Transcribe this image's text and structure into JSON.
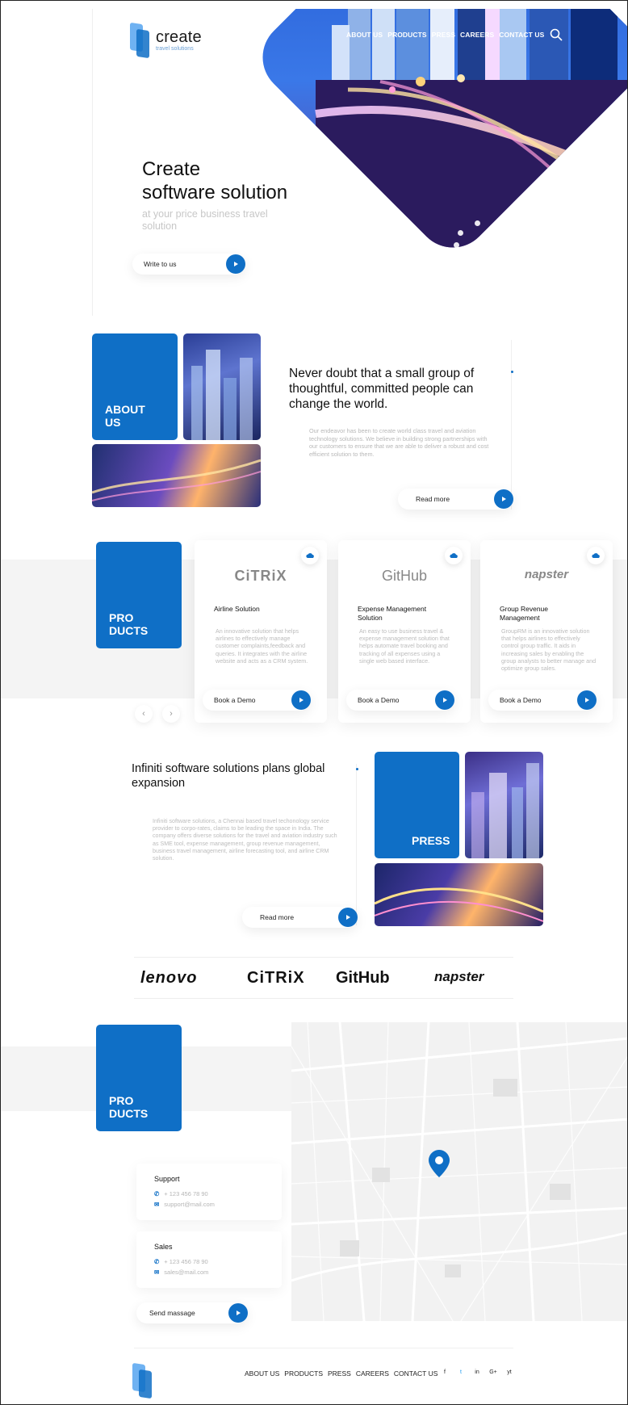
{
  "brand": {
    "name": "create",
    "tagline": "travel solutions"
  },
  "colors": {
    "accent": "#0f6fc6",
    "band": "#f4f4f4",
    "muted": "#bcbcbc"
  },
  "nav": {
    "items": [
      "ABOUT US",
      "PRODUCTS",
      "PRESS",
      "CAREERS",
      "CONTACT US"
    ],
    "search_icon": "search-icon"
  },
  "hero": {
    "title_line1": "Create",
    "title_line2": "software solution",
    "subtitle": "at your price business travel solution",
    "cta": "Write to us"
  },
  "about": {
    "label": "ABOUT US",
    "heading": "Never doubt that a small group of thoughtful, committed people can change the world.",
    "body": "Our endeavor has been to create world class travel and aviation technology solutions. We believe in building strong partnerships with our customers to ensure that we are able to deliver a robust and cost efficient solution to them.",
    "cta": "Read more"
  },
  "products": {
    "label": "PRODUCTS",
    "cards": [
      {
        "brand": "CiTRiX",
        "title": "Airline Solution",
        "desc": "An innovative solution that helps airlines to effectively manage customer complaints,feedback and queries. It integrates with the airline website and acts as a CRM system.",
        "cta": "Book a Demo"
      },
      {
        "brand": "GitHub",
        "title": "Expense Management Solution",
        "desc": "An easy to use business travel & expense management solution that helps automate travel booking and tracking of all expenses using a single web based interface.",
        "cta": "Book a Demo"
      },
      {
        "brand": "napster",
        "title": "Group Revenue Management",
        "desc": "GroupRM is an innovative solution that helps airlines to effectively control group traffic. It aids in increasing sales by enabling the group analysts to better manage and optimize group sales.",
        "cta": "Book a Demo"
      }
    ],
    "prev": "‹",
    "next": "›"
  },
  "press": {
    "label": "PRESS",
    "heading": "Infiniti software solutions plans global expansion",
    "body": "Infiniti software solutions, a Chennai based travel techonology service provider to corpo-rates, claims to be leading the space in India. The company offers diverse solutions for the travel and aviation industry such as SME tool, expense management, group revenue management, business travel management, airline forecasting tool, and airline CRM solution.",
    "cta": "Read more"
  },
  "partners": [
    "lenovo",
    "CiTRiX",
    "GitHub",
    "napster"
  ],
  "contact": {
    "label": "PRODUCTS",
    "support": {
      "title": "Support",
      "phone": "+ 123 456 78 90",
      "email": "support@mail.com"
    },
    "sales": {
      "title": "Sales",
      "phone": "+ 123 456 78 90",
      "email": "sales@mail.com"
    },
    "cta": "Send massage"
  },
  "footer": {
    "nav": [
      "ABOUT US",
      "PRODUCTS",
      "PRESS",
      "CAREERS",
      "CONTACT US"
    ],
    "socials": [
      "f",
      "t",
      "in",
      "G+",
      "yt"
    ]
  }
}
